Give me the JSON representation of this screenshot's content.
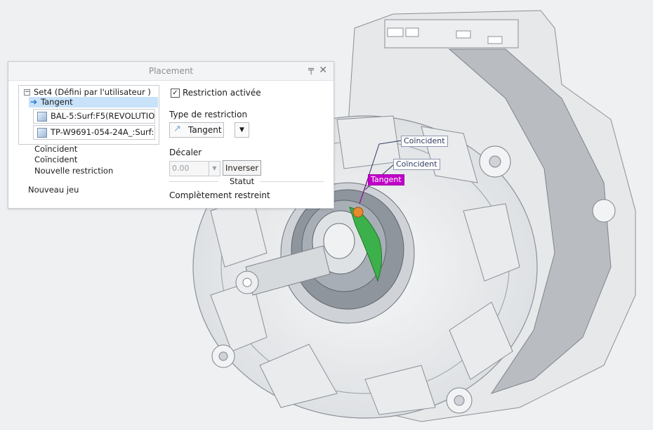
{
  "panel": {
    "title": "Placement",
    "set_label": "Set4 (Défini par l'utilisateur )",
    "selected_constraint": "Tangent",
    "references": [
      "BAL-5:Surf:F5(REVOLUTION",
      "TP-W9691-054-24A_:Surf:F"
    ],
    "other_constraints": [
      "Coïncident",
      "Coïncident",
      "Nouvelle restriction"
    ],
    "new_set": "Nouveau jeu",
    "constraint_enabled": {
      "label": "Restriction activée",
      "checked": true
    },
    "type_label": "Type de restriction",
    "type_value": "Tangent",
    "offset_label": "Décaler",
    "offset_value": "0.00",
    "invert_label": "Inverser",
    "status_label": "Statut",
    "status_value": "Complètement restreint",
    "icons": {
      "pin": "pin-icon",
      "close": "close-icon",
      "arrow": "arrow-right-icon",
      "tangent": "tangent-icon"
    }
  },
  "viewport": {
    "annotations": [
      "Coïncident",
      "Coïncident",
      "Tangent"
    ],
    "colors": {
      "tangent_tag": "#c000c8",
      "highlight_surface": "#3cb04a",
      "part_edges": "#8b9097"
    }
  }
}
